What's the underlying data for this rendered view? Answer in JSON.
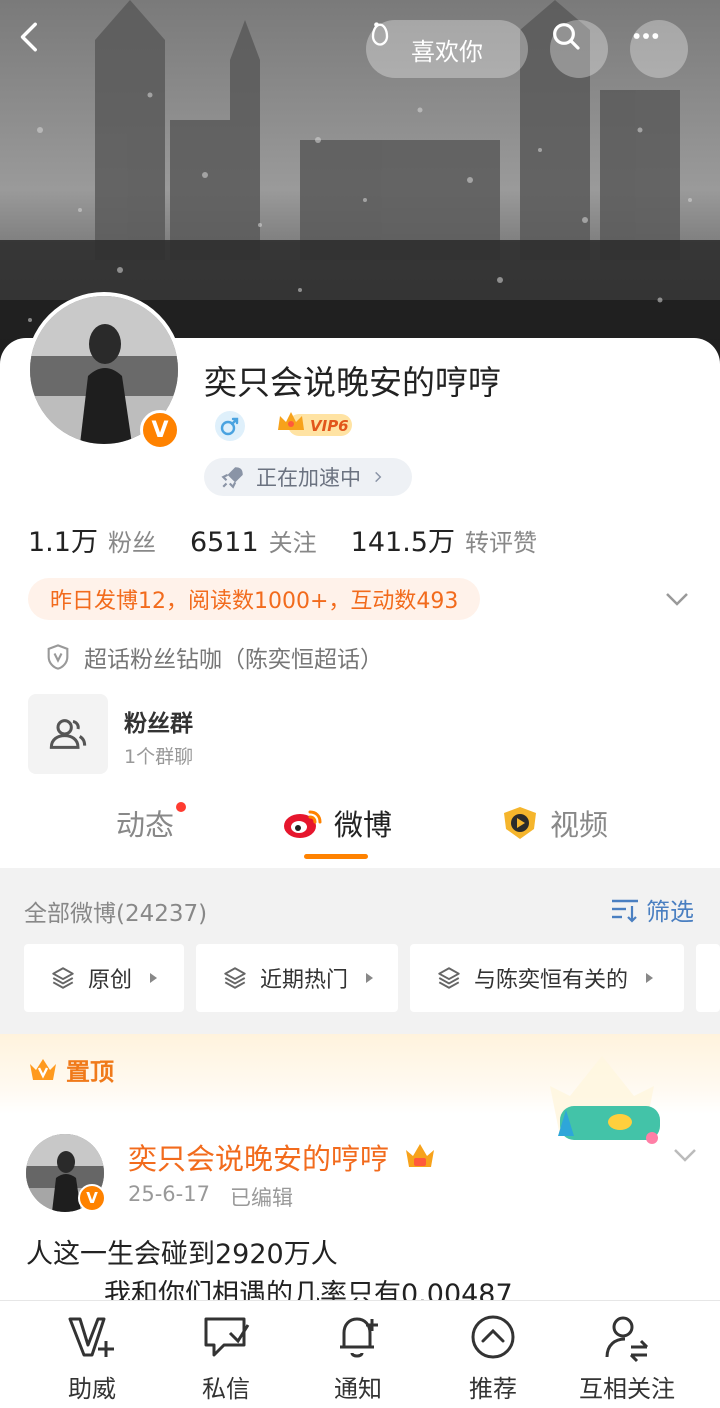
{
  "header": {
    "back_icon": "chevron-left-icon",
    "like_label": "喜欢你",
    "like_icon": "hand-heart-icon",
    "search_icon": "search-icon",
    "more_icon": "more-dots-icon"
  },
  "profile": {
    "username": "奕只会说晚安的哼哼",
    "verified_badge": "V",
    "gender_icon": "male-icon",
    "vip_label": "VIP6",
    "speed_label": "正在加速中",
    "stats": [
      {
        "value": "1.1万",
        "label": "粉丝"
      },
      {
        "value": "6511",
        "label": "关注"
      },
      {
        "value": "141.5万",
        "label": "转评赞"
      }
    ],
    "activity_summary": "昨日发博12，阅读数1000+，互动数493",
    "supertopic": "超话粉丝钻咖（陈奕恒超话）",
    "fan_group": {
      "title": "粉丝群",
      "subtitle": "1个群聊"
    }
  },
  "tabs": [
    {
      "label": "动态",
      "active": false,
      "dot": true
    },
    {
      "label": "微博",
      "active": true
    },
    {
      "label": "视频",
      "active": false
    }
  ],
  "feed": {
    "all_label": "全部微博(24237)",
    "filter_label": "筛选",
    "chips": [
      "原创",
      "近期热门",
      "与陈奕恒有关的"
    ],
    "pinned_label": "置顶",
    "post": {
      "author": "奕只会说晚安的哼哼",
      "verified_badge": "V",
      "date": "25-6-17",
      "edited": "已编辑",
      "line1": "人这一生会碰到2920万人",
      "line2": "我和你们相遇的几率只有0.00487"
    }
  },
  "bottom_bar": [
    {
      "label": "助威",
      "icon": "cheer-v-icon"
    },
    {
      "label": "私信",
      "icon": "message-icon"
    },
    {
      "label": "通知",
      "icon": "bell-plus-icon"
    },
    {
      "label": "推荐",
      "icon": "recommend-up-icon"
    },
    {
      "label": "互相关注",
      "icon": "mutual-follow-icon"
    }
  ],
  "colors": {
    "accent": "#ff8200",
    "orange_text": "#f26b1d",
    "link_blue": "#4a7fc1",
    "badge_red": "#ff3b30"
  }
}
